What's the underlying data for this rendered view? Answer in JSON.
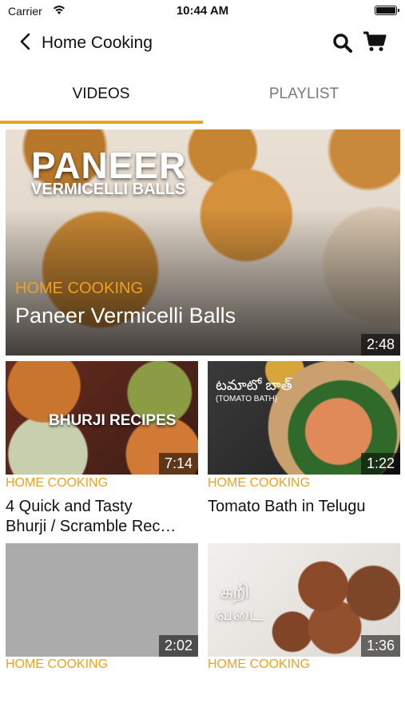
{
  "status_bar": {
    "carrier": "Carrier",
    "time": "10:44 AM"
  },
  "nav": {
    "title": "Home Cooking",
    "icons": [
      "back-chevron-icon",
      "search-icon",
      "cart-icon"
    ]
  },
  "tabs": [
    {
      "label": "VIDEOS",
      "selected": true
    },
    {
      "label": "PLAYLIST",
      "selected": false
    }
  ],
  "colors": {
    "accent": "#f0a020",
    "text": "#111111",
    "inactive_tab": "#7a7a7a"
  },
  "featured": {
    "thumb_title": "PANEER",
    "thumb_subtitle": "VERMICELLI BALLS",
    "channel": "HOME COOKING",
    "title": "Paneer Vermicelli Balls",
    "duration": "2:48"
  },
  "videos": [
    {
      "channel": "HOME COOKING",
      "title_line1": "4 Quick and Tasty",
      "title_line2": "Bhurji / Scramble Rec…",
      "duration": "7:14",
      "overlay": "BHURJI RECIPES"
    },
    {
      "channel": "HOME COOKING",
      "title_line1": "Tomato Bath in Telugu",
      "duration": "1:22",
      "overlay1": "టమాటో బాత్",
      "overlay2": "(TOMATO BATH)"
    },
    {
      "channel": "HOME COOKING",
      "duration": "2:02"
    },
    {
      "channel": "HOME COOKING",
      "duration": "1:36",
      "overlay1": "கறி",
      "overlay2": "வடை"
    }
  ]
}
